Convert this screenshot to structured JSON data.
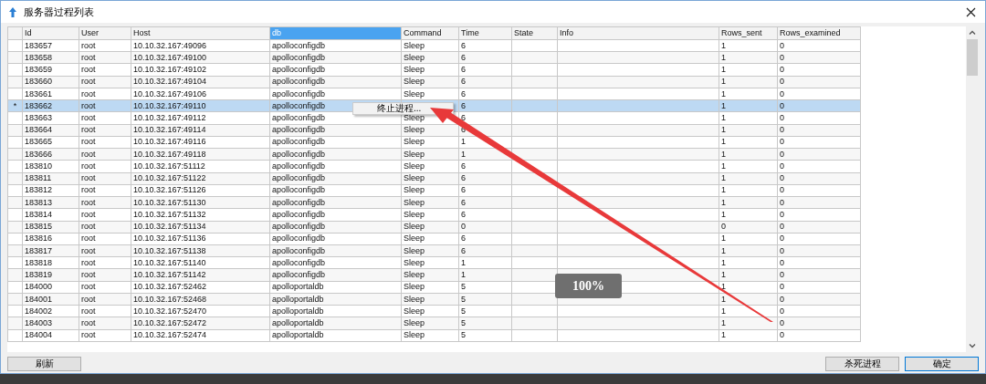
{
  "window": {
    "title": "服务器过程列表"
  },
  "table": {
    "columns": [
      {
        "label": "Id",
        "selected": false
      },
      {
        "label": "User",
        "selected": false
      },
      {
        "label": "Host",
        "selected": false
      },
      {
        "label": "db",
        "selected": true
      },
      {
        "label": "Command",
        "selected": false
      },
      {
        "label": "Time",
        "selected": false
      },
      {
        "label": "State",
        "selected": false
      },
      {
        "label": "Info",
        "selected": false
      },
      {
        "label": "Rows_sent",
        "selected": false
      },
      {
        "label": "Rows_examined",
        "selected": false
      }
    ],
    "rows": [
      {
        "id": "183657",
        "user": "root",
        "host": "10.10.32.167:49096",
        "db": "apolloconfigdb",
        "command": "Sleep",
        "time": "6",
        "rows_sent": "1",
        "rows_examined": "0",
        "selected": false
      },
      {
        "id": "183658",
        "user": "root",
        "host": "10.10.32.167:49100",
        "db": "apolloconfigdb",
        "command": "Sleep",
        "time": "6",
        "rows_sent": "1",
        "rows_examined": "0",
        "selected": false
      },
      {
        "id": "183659",
        "user": "root",
        "host": "10.10.32.167:49102",
        "db": "apolloconfigdb",
        "command": "Sleep",
        "time": "6",
        "rows_sent": "1",
        "rows_examined": "0",
        "selected": false
      },
      {
        "id": "183660",
        "user": "root",
        "host": "10.10.32.167:49104",
        "db": "apolloconfigdb",
        "command": "Sleep",
        "time": "6",
        "rows_sent": "1",
        "rows_examined": "0",
        "selected": false
      },
      {
        "id": "183661",
        "user": "root",
        "host": "10.10.32.167:49106",
        "db": "apolloconfigdb",
        "command": "Sleep",
        "time": "6",
        "rows_sent": "1",
        "rows_examined": "0",
        "selected": false
      },
      {
        "marker": "*",
        "id": "183662",
        "user": "root",
        "host": "10.10.32.167:49110",
        "db": "apolloconfigdb",
        "time": "6",
        "rows_sent": "1",
        "rows_examined": "0",
        "selected": true
      },
      {
        "id": "183663",
        "user": "root",
        "host": "10.10.32.167:49112",
        "db": "apolloconfigdb",
        "command": "Sleep",
        "time": "6",
        "rows_sent": "1",
        "rows_examined": "0",
        "selected": false
      },
      {
        "id": "183664",
        "user": "root",
        "host": "10.10.32.167:49114",
        "db": "apolloconfigdb",
        "command": "Sleep",
        "time": "6",
        "rows_sent": "1",
        "rows_examined": "0",
        "selected": false
      },
      {
        "id": "183665",
        "user": "root",
        "host": "10.10.32.167:49116",
        "db": "apolloconfigdb",
        "command": "Sleep",
        "time": "1",
        "rows_sent": "1",
        "rows_examined": "0",
        "selected": false
      },
      {
        "id": "183666",
        "user": "root",
        "host": "10.10.32.167:49118",
        "db": "apolloconfigdb",
        "command": "Sleep",
        "time": "1",
        "rows_sent": "1",
        "rows_examined": "0",
        "selected": false
      },
      {
        "id": "183810",
        "user": "root",
        "host": "10.10.32.167:51112",
        "db": "apolloconfigdb",
        "command": "Sleep",
        "time": "6",
        "rows_sent": "1",
        "rows_examined": "0",
        "selected": false
      },
      {
        "id": "183811",
        "user": "root",
        "host": "10.10.32.167:51122",
        "db": "apolloconfigdb",
        "command": "Sleep",
        "time": "6",
        "rows_sent": "1",
        "rows_examined": "0",
        "selected": false
      },
      {
        "id": "183812",
        "user": "root",
        "host": "10.10.32.167:51126",
        "db": "apolloconfigdb",
        "command": "Sleep",
        "time": "6",
        "rows_sent": "1",
        "rows_examined": "0",
        "selected": false
      },
      {
        "id": "183813",
        "user": "root",
        "host": "10.10.32.167:51130",
        "db": "apolloconfigdb",
        "command": "Sleep",
        "time": "6",
        "rows_sent": "1",
        "rows_examined": "0",
        "selected": false
      },
      {
        "id": "183814",
        "user": "root",
        "host": "10.10.32.167:51132",
        "db": "apolloconfigdb",
        "command": "Sleep",
        "time": "6",
        "rows_sent": "1",
        "rows_examined": "0",
        "selected": false
      },
      {
        "id": "183815",
        "user": "root",
        "host": "10.10.32.167:51134",
        "db": "apolloconfigdb",
        "command": "Sleep",
        "time": "0",
        "rows_sent": "0",
        "rows_examined": "0",
        "selected": false
      },
      {
        "id": "183816",
        "user": "root",
        "host": "10.10.32.167:51136",
        "db": "apolloconfigdb",
        "command": "Sleep",
        "time": "6",
        "rows_sent": "1",
        "rows_examined": "0",
        "selected": false
      },
      {
        "id": "183817",
        "user": "root",
        "host": "10.10.32.167:51138",
        "db": "apolloconfigdb",
        "command": "Sleep",
        "time": "6",
        "rows_sent": "1",
        "rows_examined": "0",
        "selected": false
      },
      {
        "id": "183818",
        "user": "root",
        "host": "10.10.32.167:51140",
        "db": "apolloconfigdb",
        "command": "Sleep",
        "time": "1",
        "rows_sent": "1",
        "rows_examined": "0",
        "selected": false
      },
      {
        "id": "183819",
        "user": "root",
        "host": "10.10.32.167:51142",
        "db": "apolloconfigdb",
        "command": "Sleep",
        "time": "1",
        "rows_sent": "1",
        "rows_examined": "0",
        "selected": false
      },
      {
        "id": "184000",
        "user": "root",
        "host": "10.10.32.167:52462",
        "db": "apolloportaldb",
        "command": "Sleep",
        "time": "5",
        "rows_sent": "1",
        "rows_examined": "0",
        "selected": false
      },
      {
        "id": "184001",
        "user": "root",
        "host": "10.10.32.167:52468",
        "db": "apolloportaldb",
        "command": "Sleep",
        "time": "5",
        "rows_sent": "1",
        "rows_examined": "0",
        "selected": false
      },
      {
        "id": "184002",
        "user": "root",
        "host": "10.10.32.167:52470",
        "db": "apolloportaldb",
        "command": "Sleep",
        "time": "5",
        "rows_sent": "1",
        "rows_examined": "0",
        "selected": false
      },
      {
        "id": "184003",
        "user": "root",
        "host": "10.10.32.167:52472",
        "db": "apolloportaldb",
        "command": "Sleep",
        "time": "5",
        "rows_sent": "1",
        "rows_examined": "0",
        "selected": false
      },
      {
        "id": "184004",
        "user": "root",
        "host": "10.10.32.167:52474",
        "db": "apolloportaldb",
        "command": "Sleep",
        "time": "5",
        "rows_sent": "1",
        "rows_examined": "0",
        "selected": false
      }
    ]
  },
  "context_menu": {
    "items": [
      {
        "label": "终止进程..."
      }
    ]
  },
  "zoom_indicator": "100%",
  "footer": {
    "left_buttons": [
      {
        "label": "刷新",
        "default": false
      }
    ],
    "right_buttons": [
      {
        "label": "杀死进程",
        "default": false
      },
      {
        "label": "确定",
        "default": true
      }
    ]
  }
}
